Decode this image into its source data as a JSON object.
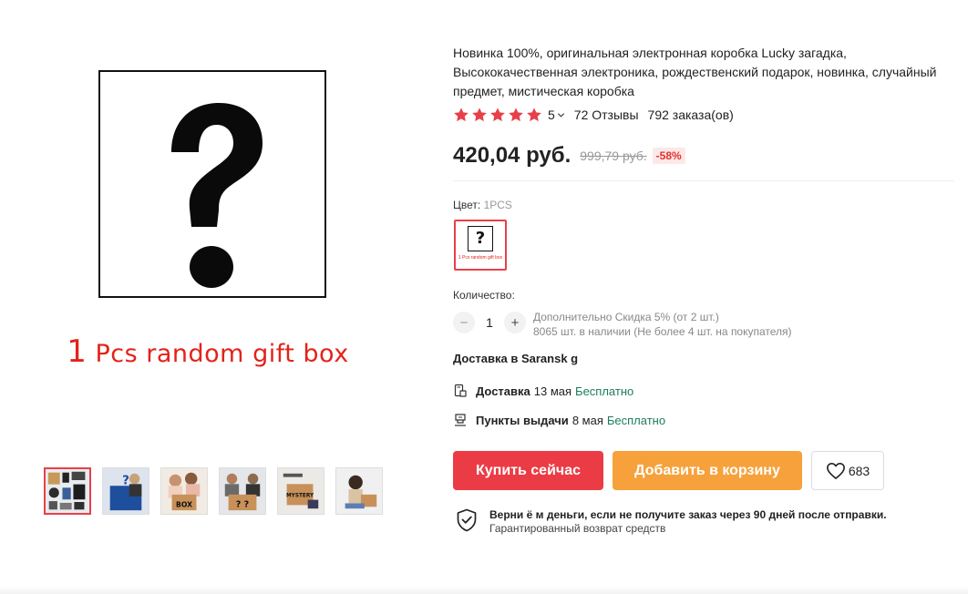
{
  "product": {
    "title": "Новинка 100%, оригинальная электронная коробка Lucky загадка, Высококачественная электроника, рождественский подарок, новинка, случайный предмет, мистическая коробка",
    "image_caption_number": "1",
    "image_caption_text": " Pcs random gift box",
    "image_symbol": "?",
    "thumbnails": [
      "electronics-collage",
      "mystery-box-person",
      "mystery-box-girls",
      "mystery-box-family",
      "mystery-box-items",
      "mystery-box-child"
    ]
  },
  "rating": {
    "stars": 5,
    "value": "5",
    "reviews": "72 Отзывы",
    "orders": "792 заказа(ов)"
  },
  "price": {
    "current": "420,04 руб.",
    "old": "999,79 руб.",
    "discount": "-58%"
  },
  "color": {
    "label": "Цвет:",
    "selected": "1PCS",
    "swatch_symbol": "?",
    "swatch_caption": "1 Pcs random gift box"
  },
  "quantity": {
    "label": "Количество:",
    "minus": "−",
    "value": "1",
    "plus": "+",
    "discount_info": "Дополнительно Скидка 5% (от 2 шт.)",
    "stock_info": "8065 шт. в наличии (Не более 4 шт. на покупателя)"
  },
  "shipping": {
    "title": "Доставка в Saransk g",
    "delivery": {
      "label": "Доставка",
      "date": "13 мая",
      "cost": "Бесплатно"
    },
    "pickup": {
      "label": "Пункты выдачи",
      "date": "8 мая",
      "cost": "Бесплатно"
    }
  },
  "actions": {
    "buy_now": "Купить сейчас",
    "add_to_cart": "Добавить в корзину",
    "wishlist_count": "683"
  },
  "guarantee": {
    "title": "Верни ё м деньги, если не получите заказ через 90 дней после отправки.",
    "subtitle": "Гарантированный возврат средств"
  },
  "colors": {
    "accent_red": "#eb3c45",
    "cart_orange": "#f6a13b",
    "free_green": "#1e7d5a",
    "star": "#e8404a"
  }
}
